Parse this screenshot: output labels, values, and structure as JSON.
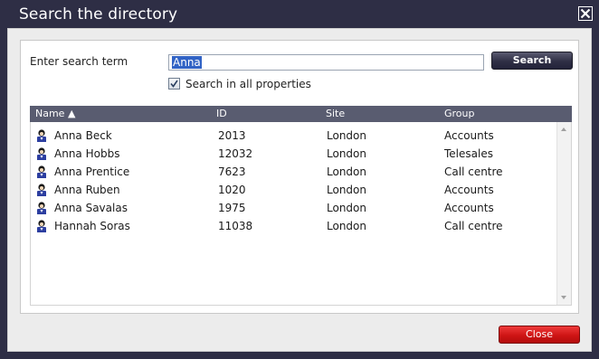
{
  "dialog": {
    "title": "Search the directory",
    "close_icon": "close-x-icon"
  },
  "search": {
    "label": "Enter search term",
    "value": "Anna",
    "button_label": "Search",
    "checkbox_label": "Search in all properties",
    "checkbox_checked": true
  },
  "table": {
    "headers": {
      "name": "Name ▲",
      "id": "ID",
      "site": "Site",
      "group": "Group"
    },
    "row_icon": "person-icon",
    "rows": [
      {
        "name": "Anna Beck",
        "id": "2013",
        "site": "London",
        "group": "Accounts"
      },
      {
        "name": "Anna Hobbs",
        "id": "12032",
        "site": "London",
        "group": "Telesales"
      },
      {
        "name": "Anna Prentice",
        "id": "7623",
        "site": "London",
        "group": "Call centre"
      },
      {
        "name": "Anna Ruben",
        "id": "1020",
        "site": "London",
        "group": "Accounts"
      },
      {
        "name": "Anna Savalas",
        "id": "1975",
        "site": "London",
        "group": "Accounts"
      },
      {
        "name": "Hannah Soras",
        "id": "11038",
        "site": "London",
        "group": "Call centre"
      }
    ]
  },
  "footer": {
    "close_label": "Close"
  },
  "colors": {
    "title_bar": "#2e2e45",
    "table_header": "#595c70",
    "close_button": "#cf1515",
    "selection": "#3163c5"
  }
}
